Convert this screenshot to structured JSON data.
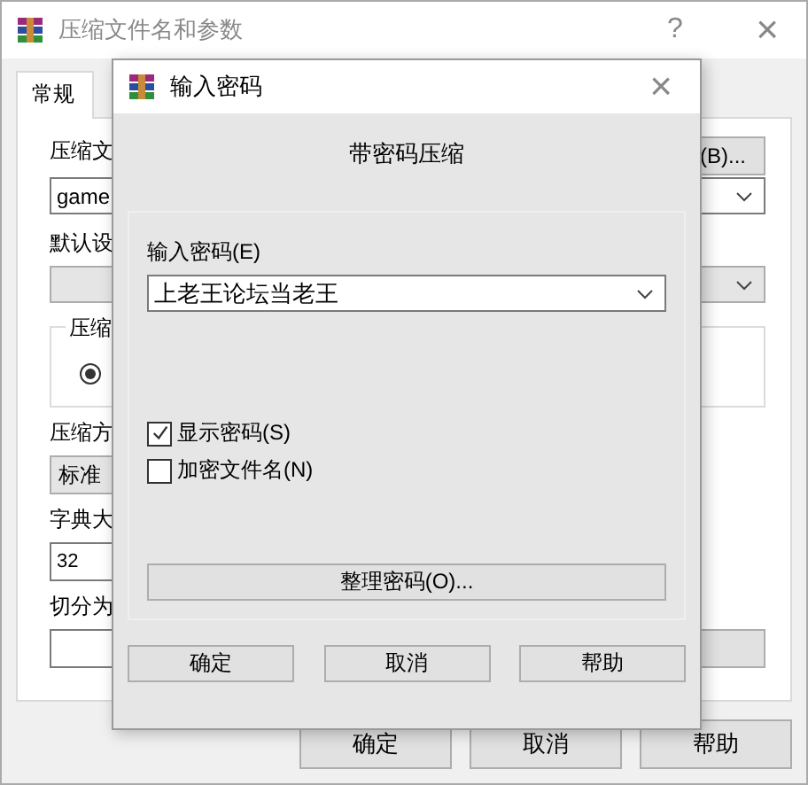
{
  "main_window": {
    "title": "压缩文件名和参数",
    "help_button": "?",
    "close_button": "×"
  },
  "tabs": [
    {
      "label": "常规",
      "selected": true
    }
  ],
  "general": {
    "archive_name_label": "压缩文",
    "browse_button": "(B)...",
    "archive_name": "game",
    "profile_label": "默认设",
    "archive_format_group": "压缩",
    "format_radio": {
      "selected": true
    },
    "method_label": "压缩方",
    "method": "标准",
    "dictionary_label": "字典大",
    "dictionary": "32",
    "split_label": "切分为"
  },
  "buttons": [
    "确定",
    "取消",
    "帮助"
  ],
  "password_dialog": {
    "title": "输入密码",
    "close_button": "×",
    "heading": "带密码压缩",
    "password_label": "输入密码(E)",
    "password": "上老王论坛当老王",
    "options": [
      {
        "label": "显示密码(S)",
        "checked": true
      },
      {
        "label": "加密文件名(N)",
        "checked": false
      }
    ],
    "organize_button": "整理密码(O)...",
    "buttons": [
      "确定",
      "取消",
      "帮助"
    ]
  }
}
